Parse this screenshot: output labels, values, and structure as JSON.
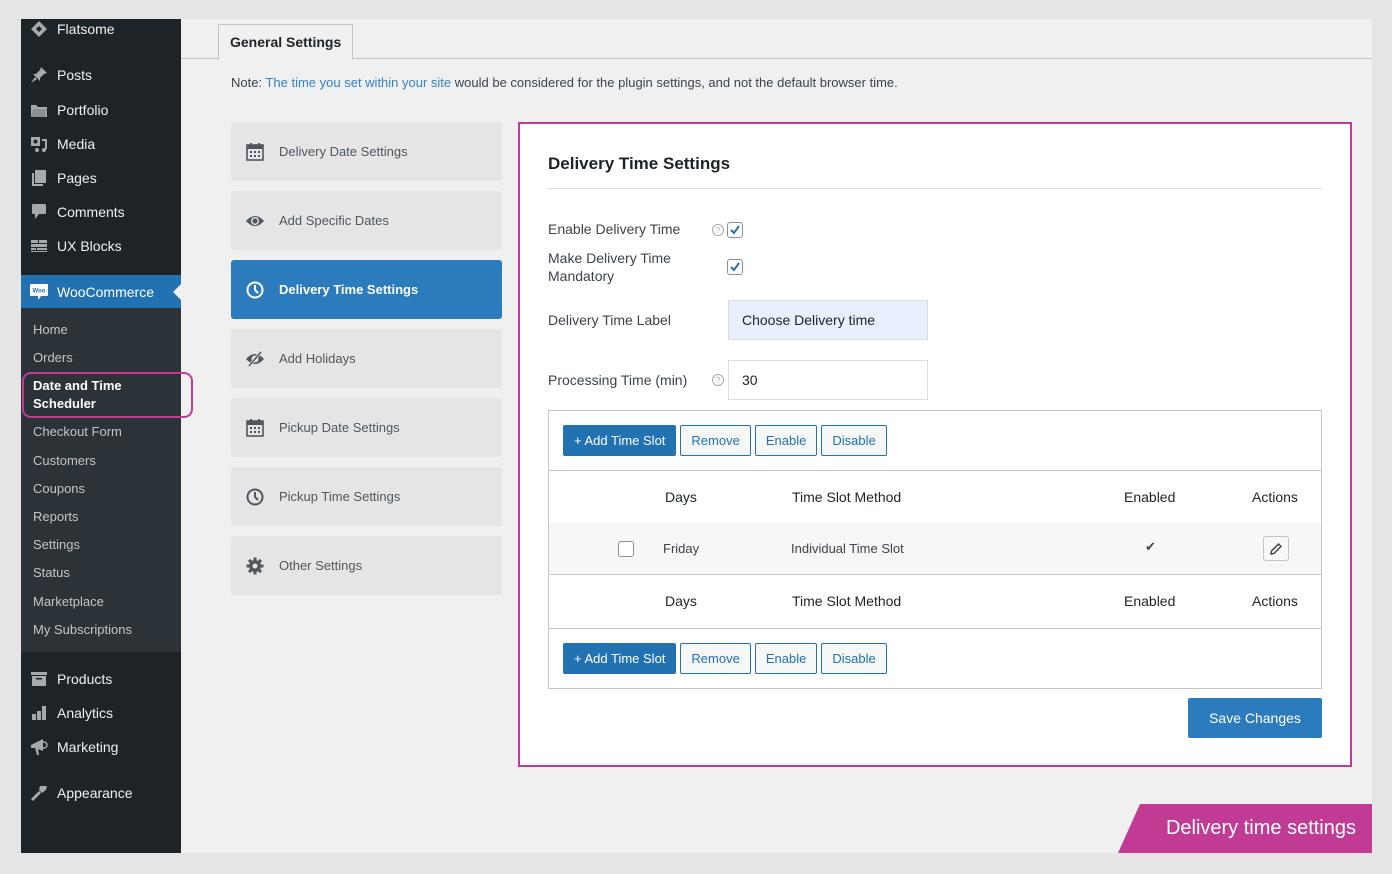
{
  "sidebar": {
    "top_items": [
      {
        "label": "Flatsome",
        "icon": "flatsome-diamond-icon"
      },
      {
        "label": "Posts",
        "icon": "pushpin-icon"
      },
      {
        "label": "Portfolio",
        "icon": "folder-icon"
      },
      {
        "label": "Media",
        "icon": "media-icon"
      },
      {
        "label": "Pages",
        "icon": "pages-icon"
      },
      {
        "label": "Comments",
        "icon": "comment-icon"
      },
      {
        "label": "UX Blocks",
        "icon": "blocks-icon"
      }
    ],
    "woocommerce": {
      "label": "WooCommerce",
      "icon": "woo-icon"
    },
    "submenu": [
      {
        "label": "Home"
      },
      {
        "label": "Orders"
      },
      {
        "label": "Date and Time Scheduler",
        "current": true
      },
      {
        "label": "Checkout Form"
      },
      {
        "label": "Customers"
      },
      {
        "label": "Coupons"
      },
      {
        "label": "Reports"
      },
      {
        "label": "Settings"
      },
      {
        "label": "Status"
      },
      {
        "label": "Marketplace"
      },
      {
        "label": "My Subscriptions"
      }
    ],
    "bottom_items": [
      {
        "label": "Products",
        "icon": "archive-icon"
      },
      {
        "label": "Analytics",
        "icon": "bar-chart-icon"
      },
      {
        "label": "Marketing",
        "icon": "megaphone-icon"
      },
      {
        "label": "Appearance",
        "icon": "paintbrush-icon"
      }
    ]
  },
  "tabs": {
    "general": "General Settings"
  },
  "note": {
    "prefix": "Note: ",
    "link": "The time you set within your site",
    "suffix": " would be considered for the plugin settings, and not the default browser time."
  },
  "settings_nav": [
    {
      "label": "Delivery Date Settings",
      "icon": "calendar-icon"
    },
    {
      "label": "Add Specific Dates",
      "icon": "eye-icon"
    },
    {
      "label": "Delivery Time Settings",
      "icon": "clock-icon",
      "active": true
    },
    {
      "label": "Add Holidays",
      "icon": "eye-slash-icon"
    },
    {
      "label": "Pickup Date Settings",
      "icon": "calendar-icon"
    },
    {
      "label": "Pickup Time Settings",
      "icon": "clock-icon"
    },
    {
      "label": "Other Settings",
      "icon": "gear-icon"
    }
  ],
  "panel": {
    "title": "Delivery Time Settings",
    "fields": {
      "enable_label": "Enable Delivery Time",
      "enable_checked": true,
      "mandatory_label": "Make Delivery Time Mandatory",
      "mandatory_checked": true,
      "time_label_label": "Delivery Time Label",
      "time_label_value": "Choose Delivery time",
      "processing_label": "Processing Time (min)",
      "processing_value": "30"
    },
    "buttons": {
      "add": "+ Add Time Slot",
      "remove": "Remove",
      "enable": "Enable",
      "disable": "Disable"
    },
    "table": {
      "headers": [
        "Days",
        "Time Slot Method",
        "Enabled",
        "Actions"
      ],
      "rows": [
        {
          "day": "Friday",
          "method": "Individual Time Slot",
          "enabled": "✔",
          "checked": false
        }
      ]
    },
    "save": "Save Changes"
  },
  "caption": "Delivery time settings",
  "colors": {
    "accent": "#2271b1",
    "highlight": "#c13b95",
    "sidebar": "#1d2327"
  }
}
